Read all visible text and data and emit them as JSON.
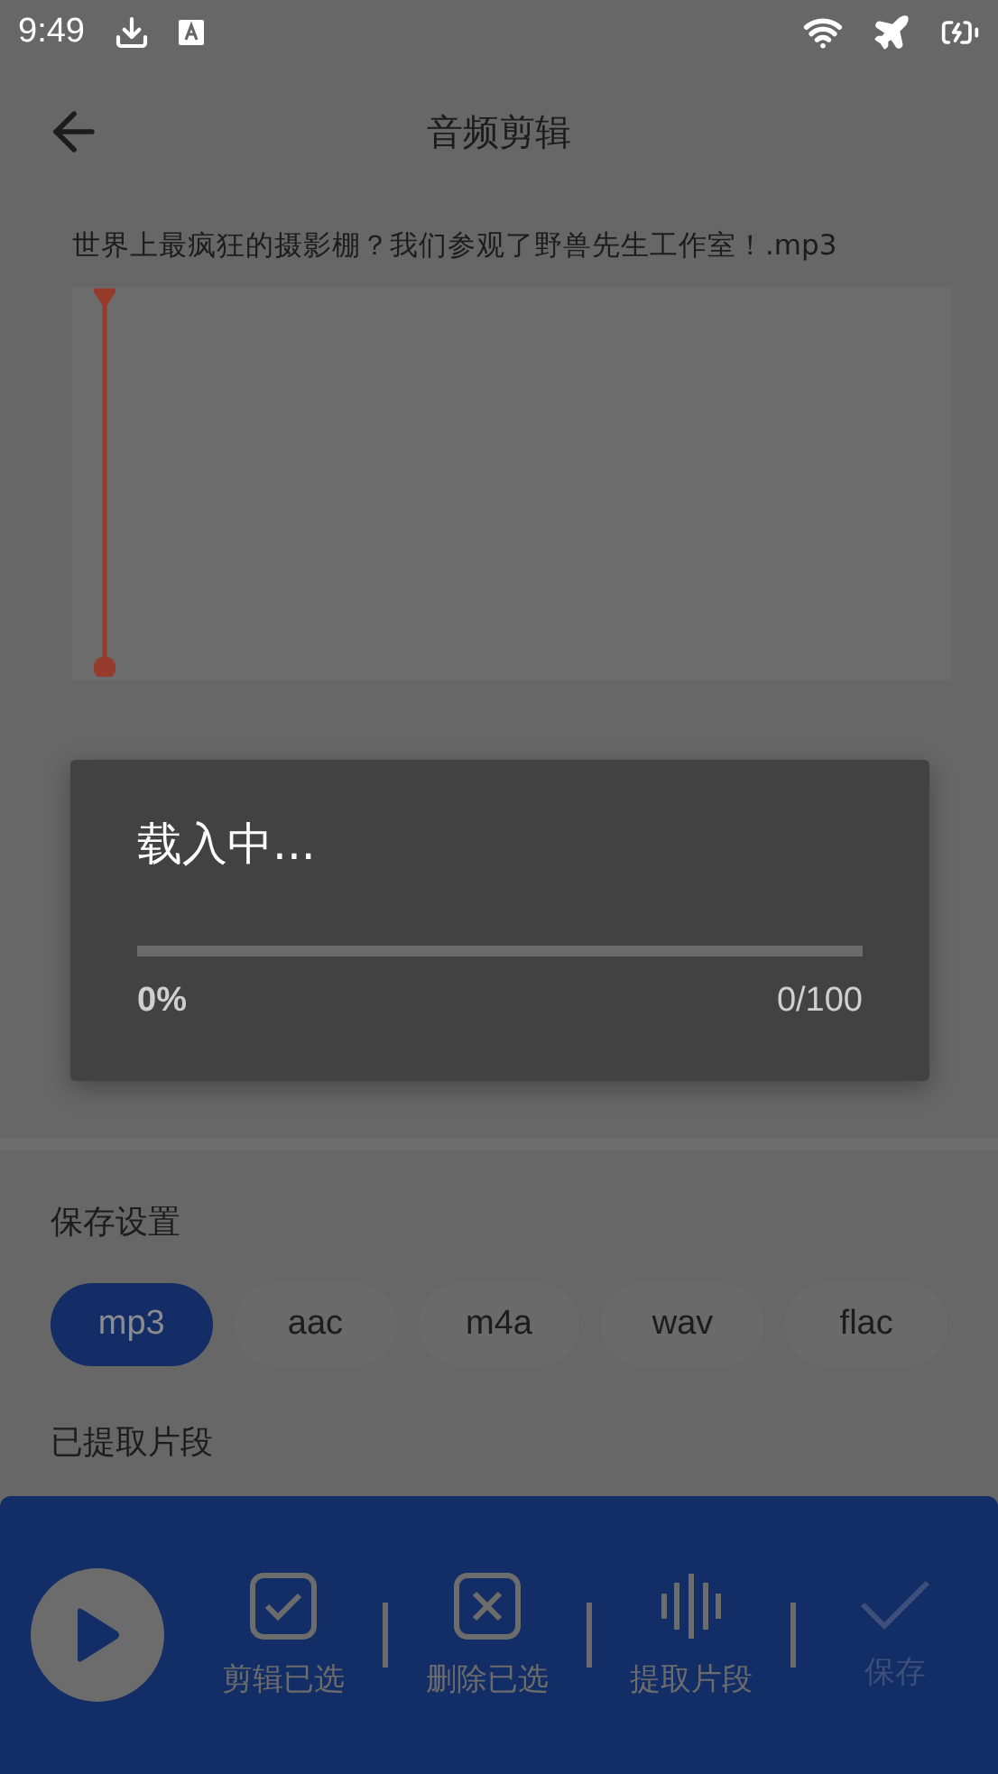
{
  "status_bar": {
    "time": "9:49"
  },
  "app_bar": {
    "title": "音频剪辑"
  },
  "file_name": "世界上最疯狂的摄影棚？我们参观了野兽先生工作室！.mp3",
  "save_settings": {
    "title": "保存设置",
    "formats": [
      {
        "label": "mp3",
        "selected": true
      },
      {
        "label": "aac",
        "selected": false
      },
      {
        "label": "m4a",
        "selected": false
      },
      {
        "label": "wav",
        "selected": false
      },
      {
        "label": "flac",
        "selected": false
      }
    ]
  },
  "extracted_section": {
    "title": "已提取片段"
  },
  "bottom_bar": {
    "actions": [
      {
        "kind": "check",
        "label": "剪辑已选",
        "disabled": false
      },
      {
        "kind": "cross",
        "label": "删除已选",
        "disabled": false
      },
      {
        "kind": "wave",
        "label": "提取片段",
        "disabled": false
      },
      {
        "kind": "save",
        "label": "保存",
        "disabled": true
      }
    ]
  },
  "loading_dialog": {
    "title": "载入中...",
    "level": 0,
    "percent": "0%",
    "count": "0/100"
  }
}
